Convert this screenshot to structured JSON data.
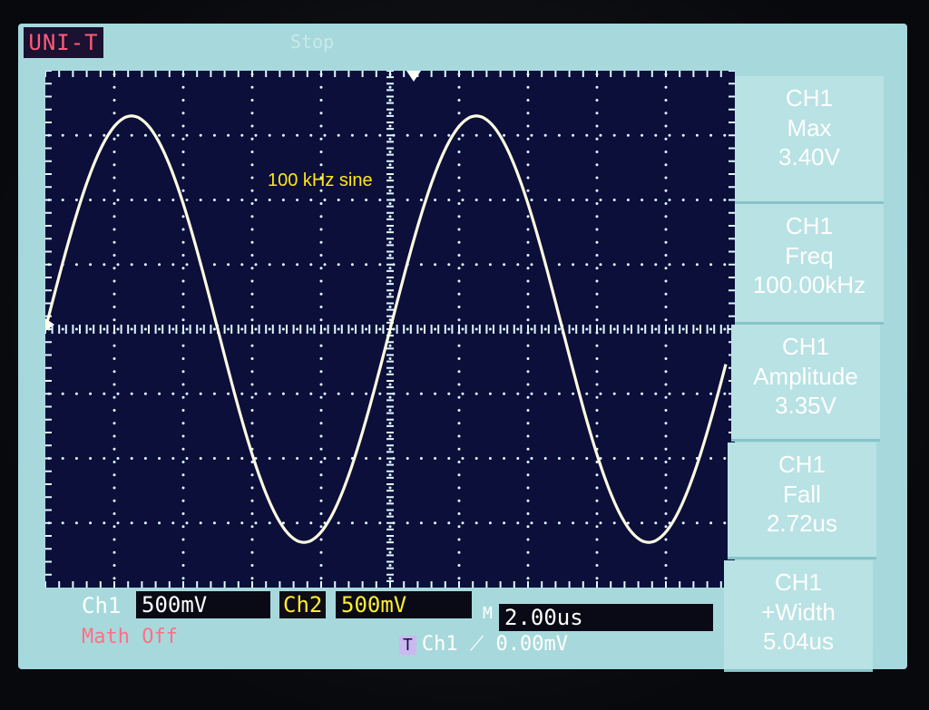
{
  "brand": "UNI-T",
  "status_top": "Stop",
  "annotation": "100 kHz sine",
  "trace": {
    "frequency_hz": 100000,
    "amplitude_divisions": 3.3,
    "time_per_div_us": 2.0
  },
  "measure_menu": [
    {
      "title": "CH1",
      "subtitle": "Max",
      "value": "3.40V"
    },
    {
      "title": "CH1",
      "subtitle": "Freq",
      "value": "100.00kHz"
    },
    {
      "title": "CH1",
      "subtitle": "Amplitude",
      "value": "3.35V"
    },
    {
      "title": "CH1",
      "subtitle": "Fall",
      "value": "2.72us"
    },
    {
      "title": "CH1",
      "subtitle": "+Width",
      "value": "5.04us"
    }
  ],
  "bottom": {
    "ch1_label": "Ch1",
    "ch1_scale": "500mV",
    "ch2_label": "Ch2",
    "ch2_scale": "500mV",
    "timebase_label": "M",
    "timebase_value": "2.00us",
    "math": "Math Off",
    "trigger_badge": "T",
    "trigger_text": "Ch1 ⟋ 0.00mV"
  },
  "colors": {
    "trace": "#fffbe0",
    "grid": "#dff7ff",
    "plot_bg": "#0b0f3a",
    "annotation": "#ffe61a"
  }
}
